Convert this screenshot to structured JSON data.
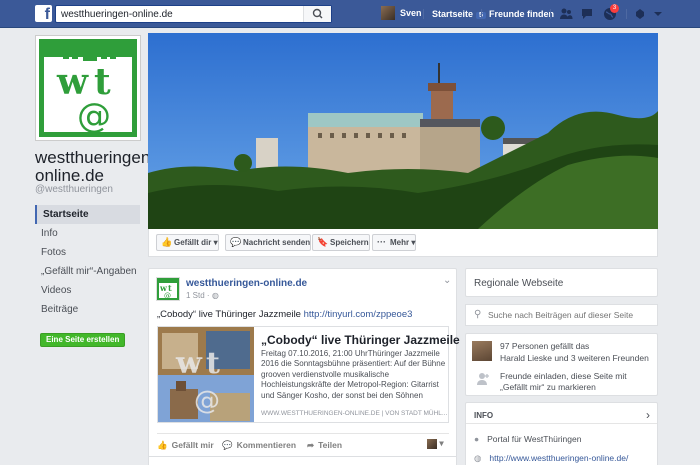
{
  "topbar": {
    "logo": "f",
    "search_value": "westthueringen-online.de",
    "user_name": "Sven",
    "home_label": "Startseite",
    "home_count": "5",
    "find_friends": "Freunde finden",
    "notifications_count": "3"
  },
  "page": {
    "logo_text_w": "w",
    "logo_text_t": "t",
    "logo_text_at": "@",
    "name": "westthueringen-online.de",
    "handle": "@westthueringen"
  },
  "nav": {
    "items": [
      {
        "label": "Startseite"
      },
      {
        "label": "Info"
      },
      {
        "label": "Fotos"
      },
      {
        "label": "„Gefällt mir“-Angaben"
      },
      {
        "label": "Videos"
      },
      {
        "label": "Beiträge"
      }
    ],
    "create_page": "Eine Seite erstellen"
  },
  "actions": {
    "like": "Gefällt dir",
    "message": "Nachricht senden",
    "save": "Speichern",
    "more": "Mehr"
  },
  "post": {
    "author": "westthueringen-online.de",
    "time": "1 Std ·",
    "text": "„Cobody“ live Thüringer Jazzmeile",
    "text_link": "http://tinyurl.com/zppeoe3",
    "card_title": "„Cobody“ live Thüringer Jazzmeile",
    "card_desc": "Freitag 07.10.2016, 21:00 UhrThüringer Jazzmeile 2016 die Sonntagsbühne präsentiert: Auf der Bühne grooven verdienstvolle musikalische Hochleistungskräfte der Metropol-Region: Gitarrist und Sänger Kosho, der sonst bei den Söhnen",
    "card_source": "WWW.WESTTHUERINGEN-ONLINE.DE | VON STADT MÜHL...",
    "like": "Gefällt mir",
    "comment": "Kommentieren",
    "share": "Teilen"
  },
  "right": {
    "regional_title": "Regionale Webseite",
    "search_placeholder": "Suche nach Beiträgen auf dieser Seite",
    "likes_count": "97 Personen gefällt das",
    "likes_friends": "Harald Lieske und 3 weiteren Freunden",
    "invite_text": "Freunde einladen, diese Seite mit „Gefällt mir“ zu markieren",
    "info_title": "INFO",
    "info_about": "Portal für WestThüringen",
    "info_url": "http://www.westthueringen-online.de/"
  },
  "colors": {
    "brand": "#3b5998",
    "logo_green": "#2f9e3a",
    "link": "#365899",
    "create_green": "#42b72a"
  }
}
